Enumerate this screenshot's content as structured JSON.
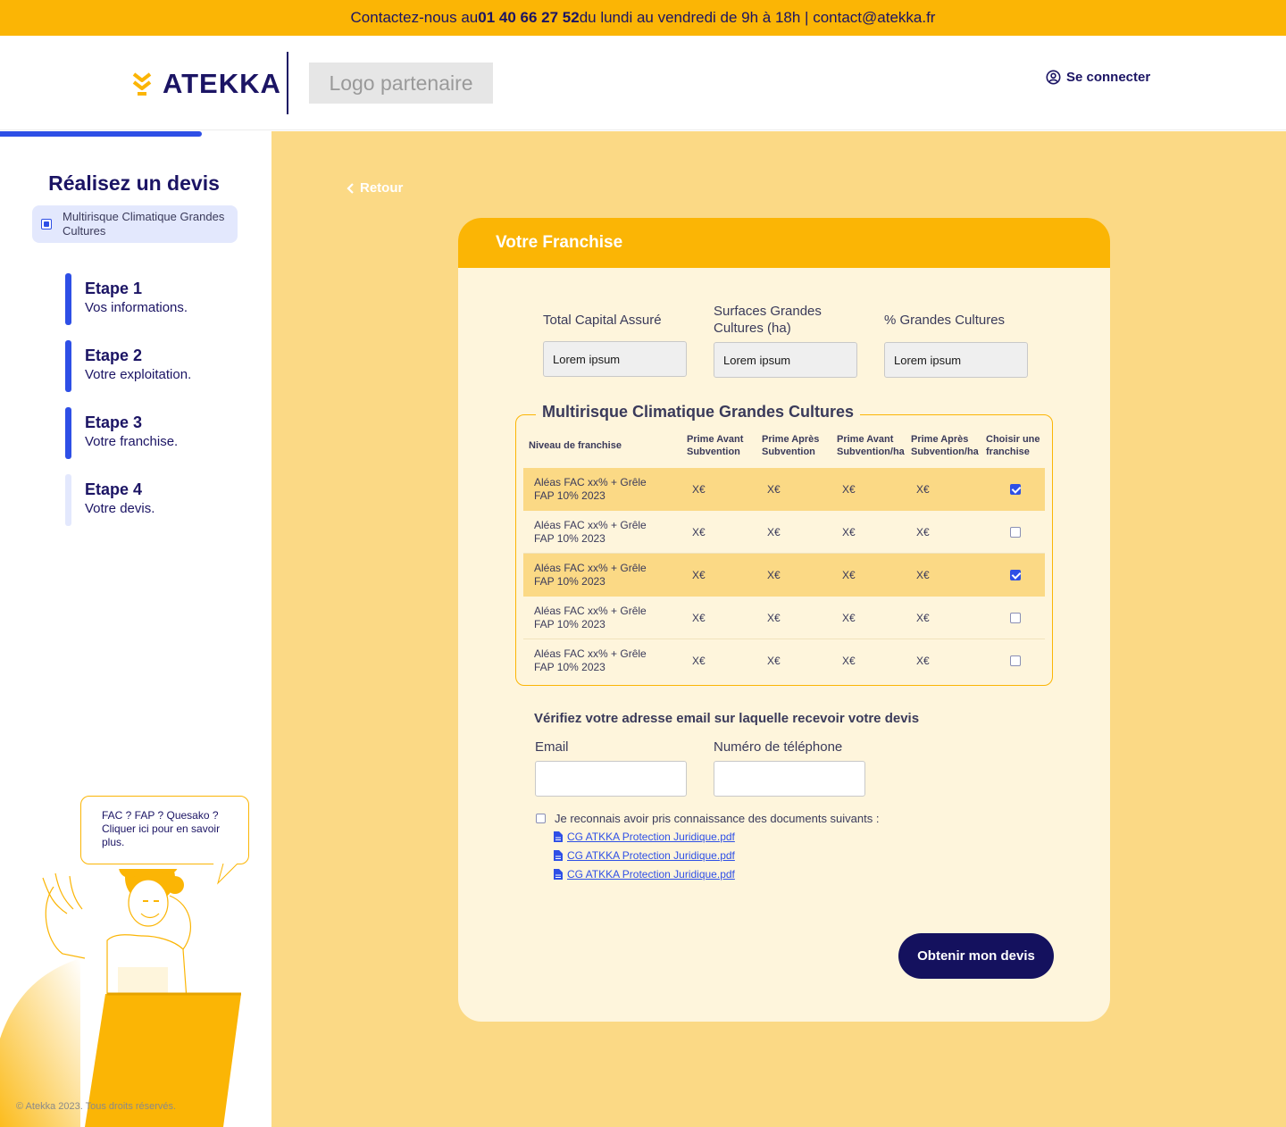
{
  "topbar": {
    "prefix": "Contactez-nous au ",
    "phone": "01 40 66 27 52",
    "suffix": " du lundi au vendredi de 9h à 18h | contact@atekka.fr"
  },
  "header": {
    "brand": "ATEKKA",
    "partner_logo": "Logo partenaire",
    "login": "Se connecter",
    "login_icon": "user-circle-icon"
  },
  "sidebar": {
    "title": "Réalisez un devis",
    "product": "Multirisque Climatique Grandes Cultures",
    "steps": [
      {
        "title": "Etape 1",
        "subtitle": "Vos informations.",
        "active": true
      },
      {
        "title": "Etape 2",
        "subtitle": "Votre exploitation.",
        "active": true
      },
      {
        "title": "Etape 3",
        "subtitle": "Votre franchise.",
        "active": true
      },
      {
        "title": "Etape 4",
        "subtitle": "Votre devis.",
        "active": false
      }
    ],
    "help_bubble": "FAC ? FAP ? Quesako ? Cliquer ici pour en savoir plus.",
    "copyright": "© Atekka 2023. Tous droits réservés."
  },
  "main": {
    "back": "Retour",
    "card_title": "Votre Franchise",
    "fields": [
      {
        "label": "Total Capital Assuré",
        "value": "Lorem ipsum"
      },
      {
        "label": "Surfaces Grandes Cultures (ha)",
        "value": "Lorem ipsum"
      },
      {
        "label": "% Grandes Cultures",
        "value": "Lorem ipsum"
      }
    ],
    "table": {
      "legend": "Multirisque Climatique Grandes Cultures",
      "headers": [
        "Niveau de franchise",
        "Prime Avant Subvention",
        "Prime Après Subvention",
        "Prime Avant Subvention/ha",
        "Prime Après Subvention/ha",
        "Choisir une franchise"
      ],
      "rows": [
        {
          "level": "Aléas FAC xx% + Grêle FAP 10% 2023",
          "v1": "X€",
          "v2": "X€",
          "v3": "X€",
          "v4": "X€",
          "checked": true
        },
        {
          "level": "Aléas FAC xx% + Grêle FAP 10% 2023",
          "v1": "X€",
          "v2": "X€",
          "v3": "X€",
          "v4": "X€",
          "checked": false
        },
        {
          "level": "Aléas FAC xx% + Grêle FAP 10% 2023",
          "v1": "X€",
          "v2": "X€",
          "v3": "X€",
          "v4": "X€",
          "checked": true
        },
        {
          "level": "Aléas FAC xx% + Grêle FAP 10% 2023",
          "v1": "X€",
          "v2": "X€",
          "v3": "X€",
          "v4": "X€",
          "checked": false
        },
        {
          "level": "Aléas FAC xx% + Grêle FAP 10% 2023",
          "v1": "X€",
          "v2": "X€",
          "v3": "X€",
          "v4": "X€",
          "checked": false
        }
      ]
    },
    "email_title": "Vérifiez votre adresse email sur laquelle recevoir votre devis",
    "email_label": "Email",
    "email_value": "",
    "phone_label": "Numéro de téléphone",
    "phone_value": "",
    "ack_text": "Je reconnais avoir pris connaissance des documents suivants :",
    "documents": [
      "CG ATKKA Protection Juridique.pdf",
      "CG ATKKA Protection Juridique.pdf",
      "CG ATKKA Protection Juridique.pdf"
    ],
    "cta": "Obtenir mon devis"
  },
  "colors": {
    "primary_yellow": "#fbb505",
    "light_yellow": "#fbd985",
    "card_bg": "#fef5dc",
    "navy": "#1b1464",
    "accent_blue": "#2e4fe6"
  }
}
